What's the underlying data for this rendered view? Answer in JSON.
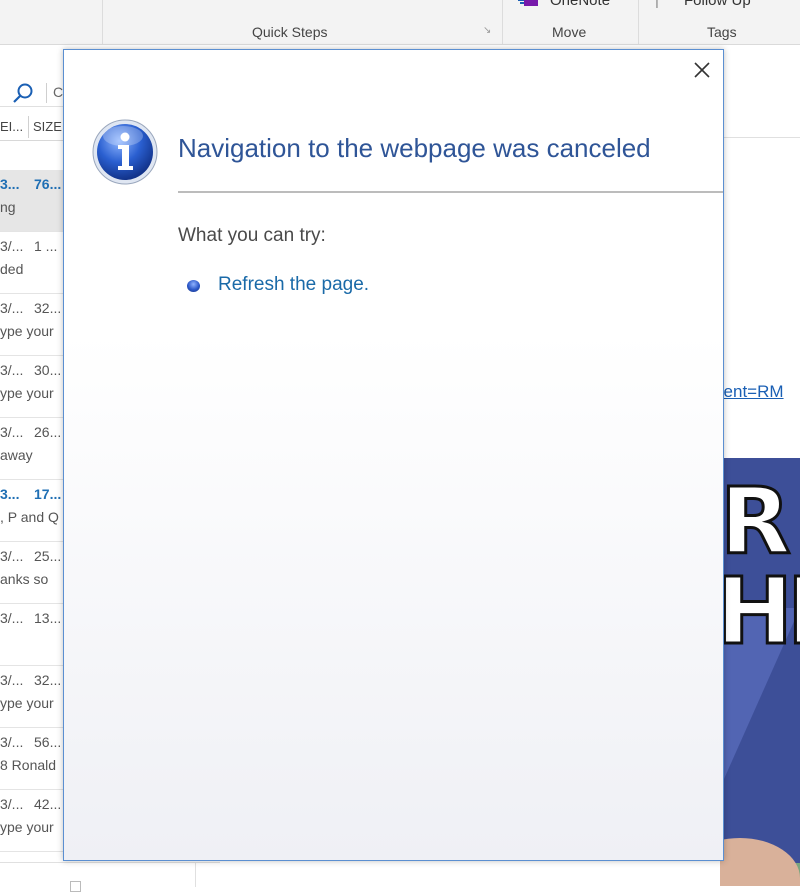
{
  "ribbon": {
    "top_onenote": "OneNote",
    "top_followup": "Follow Up",
    "groups": {
      "quick_steps": "Quick Steps",
      "move": "Move",
      "tags": "Tags"
    }
  },
  "message_list": {
    "search_fragment": "C",
    "columns": [
      "EI...",
      "SIZE"
    ],
    "rows": [
      {
        "date": "3...",
        "size": "76...",
        "preview": "ng",
        "unread": true,
        "selected": true
      },
      {
        "date": "3/...",
        "size": "1 ...",
        "preview": "ded"
      },
      {
        "date": "3/...",
        "size": "32...",
        "preview": "ype your"
      },
      {
        "date": "3/...",
        "size": "30...",
        "preview": "ype your"
      },
      {
        "date": "3/...",
        "size": "26...",
        "preview": "away"
      },
      {
        "date": "3...",
        "size": "17...",
        "preview": ", P and Q",
        "unread": true
      },
      {
        "date": "3/...",
        "size": "25...",
        "preview": "anks so"
      },
      {
        "date": "3/...",
        "size": "13...",
        "preview": ""
      },
      {
        "date": "3/...",
        "size": "32...",
        "preview": "ype your"
      },
      {
        "date": "3/...",
        "size": "56...",
        "preview": "8  Ronald"
      },
      {
        "date": "3/...",
        "size": "42...",
        "preview": "ype your"
      }
    ]
  },
  "reading_pane": {
    "link_fragment": "lient=RM",
    "meme_text_1": "R",
    "meme_text_2": "HIP"
  },
  "dialog": {
    "title": "Navigation to the webpage was canceled",
    "try_label": "What you can try:",
    "refresh_link": "Refresh the page."
  },
  "colors": {
    "title": "#2f5597",
    "link": "#1a6aa8",
    "dialog_border": "#5b8fd1",
    "unread": "#1f6fb4"
  }
}
